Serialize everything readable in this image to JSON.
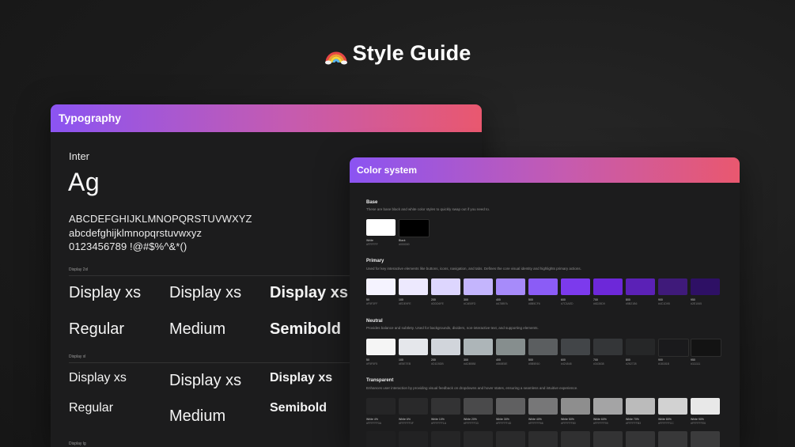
{
  "header": {
    "title": "Style Guide",
    "emoji_icon": "rainbow-icon"
  },
  "typography": {
    "card_title": "Typography",
    "font_name": "Inter",
    "sample": "Ag",
    "uppercase": "ABCDEFGHIJKLMNOPQRSTUVWXYZ",
    "lowercase": "abcdefghijklmnopqrstuvwxyz",
    "digits": "0123456789 !@#$%^&*()",
    "group1_label": "Display 2xl",
    "group2_label": "Display xl",
    "group3_label": "Display lg",
    "group1": [
      {
        "sample": "Display xs",
        "weight": "Regular"
      },
      {
        "sample": "Display xs",
        "weight": "Medium"
      },
      {
        "sample": "Display xs",
        "weight": "Semibold"
      }
    ],
    "group2": [
      {
        "sample": "Display xs",
        "weight": "Regular"
      },
      {
        "sample": "Display xs",
        "weight": "Medium"
      },
      {
        "sample": "Display xs",
        "weight": "Semibold"
      }
    ]
  },
  "color_system": {
    "card_title": "Color system",
    "base": {
      "title": "Base",
      "desc": "These are base black and white color styles to quickly swap out if you need to.",
      "swatches": [
        {
          "name": "White",
          "hex": "#FFFFFF",
          "color": "#ffffff"
        },
        {
          "name": "Black",
          "hex": "#000000",
          "color": "#000000"
        }
      ]
    },
    "primary": {
      "title": "Primary",
      "desc": "Used for key interactive elements like buttons, icons, navigation, and tabs. Defines the core visual identity and highlights primary actions.",
      "swatches": [
        {
          "name": "50",
          "hex": "#F5F3FF",
          "color": "#f5f3ff"
        },
        {
          "name": "100",
          "hex": "#EDE9FE",
          "color": "#ede9fe"
        },
        {
          "name": "200",
          "hex": "#DDD6FE",
          "color": "#ddd6fe"
        },
        {
          "name": "300",
          "hex": "#C4B5FD",
          "color": "#c4b5fd"
        },
        {
          "name": "400",
          "hex": "#A78BFA",
          "color": "#a78bfa"
        },
        {
          "name": "500",
          "hex": "#8B5CF6",
          "color": "#8b5cf6"
        },
        {
          "name": "600",
          "hex": "#7C3AED",
          "color": "#7c3aed"
        },
        {
          "name": "700",
          "hex": "#6D28D9",
          "color": "#6d28d9"
        },
        {
          "name": "800",
          "hex": "#5B21B6",
          "color": "#5b21b6"
        },
        {
          "name": "900",
          "hex": "#4C1D95",
          "color": "#3f1a7a"
        },
        {
          "name": "950",
          "hex": "#2E1065",
          "color": "#2e1065"
        }
      ]
    },
    "neutral": {
      "title": "Neutral",
      "desc": "Provides balance and subtlety. Used for backgrounds, dividers, non-interactive text, and supporting elements.",
      "swatches": [
        {
          "name": "50",
          "hex": "#F5F5F5",
          "color": "#f5f5f5"
        },
        {
          "name": "100",
          "hex": "#E5E7EB",
          "color": "#e5e7eb"
        },
        {
          "name": "200",
          "hex": "#D1D5DB",
          "color": "#d1d5db"
        },
        {
          "name": "300",
          "hex": "#ADB5B8",
          "color": "#adb5b8"
        },
        {
          "name": "400",
          "hex": "#868E8E",
          "color": "#868e8e"
        },
        {
          "name": "500",
          "hex": "#5B5E60",
          "color": "#5b5e60"
        },
        {
          "name": "600",
          "hex": "#424548",
          "color": "#424548"
        },
        {
          "name": "700",
          "hex": "#343638",
          "color": "#343638"
        },
        {
          "name": "800",
          "hex": "#262728",
          "color": "#262728"
        },
        {
          "name": "900",
          "hex": "#18181B",
          "color": "#1a1a1c"
        },
        {
          "name": "950",
          "hex": "#111111",
          "color": "#131313"
        }
      ]
    },
    "transparent": {
      "title": "Transparent",
      "desc": "Enhances user interaction by providing visual feedback on dropdowns and hover states, ensuring a seamless and intuitive experience.",
      "swatches": [
        {
          "name": "White 4%",
          "hex": "#FFFFFF0A",
          "color": "#252526"
        },
        {
          "name": "White 6%",
          "hex": "#FFFFFF0F",
          "color": "#29292a"
        },
        {
          "name": "White 10%",
          "hex": "#FFFFFF1A",
          "color": "#333334"
        },
        {
          "name": "White 20%",
          "hex": "#FFFFFF33",
          "color": "#4a4a4b"
        },
        {
          "name": "White 30%",
          "hex": "#FFFFFF4D",
          "color": "#606061"
        },
        {
          "name": "White 40%",
          "hex": "#FFFFFF66",
          "color": "#777778"
        },
        {
          "name": "White 50%",
          "hex": "#FFFFFF80",
          "color": "#8e8e8e"
        },
        {
          "name": "White 60%",
          "hex": "#FFFFFF99",
          "color": "#a4a4a5"
        },
        {
          "name": "White 70%",
          "hex": "#FFFFFFB3",
          "color": "#bbbbbb"
        },
        {
          "name": "White 80%",
          "hex": "#FFFFFFCC",
          "color": "#d2d2d2"
        },
        {
          "name": "White 90%",
          "hex": "#FFFFFFE6",
          "color": "#e8e8e8"
        }
      ],
      "row2_colors": [
        "#1f1f20",
        "#222223",
        "#252526",
        "#282829",
        "#2a2a2b",
        "#2d2d2e",
        "#303031",
        "#333334",
        "#353536",
        "#383839",
        "#3b3b3c"
      ]
    }
  }
}
